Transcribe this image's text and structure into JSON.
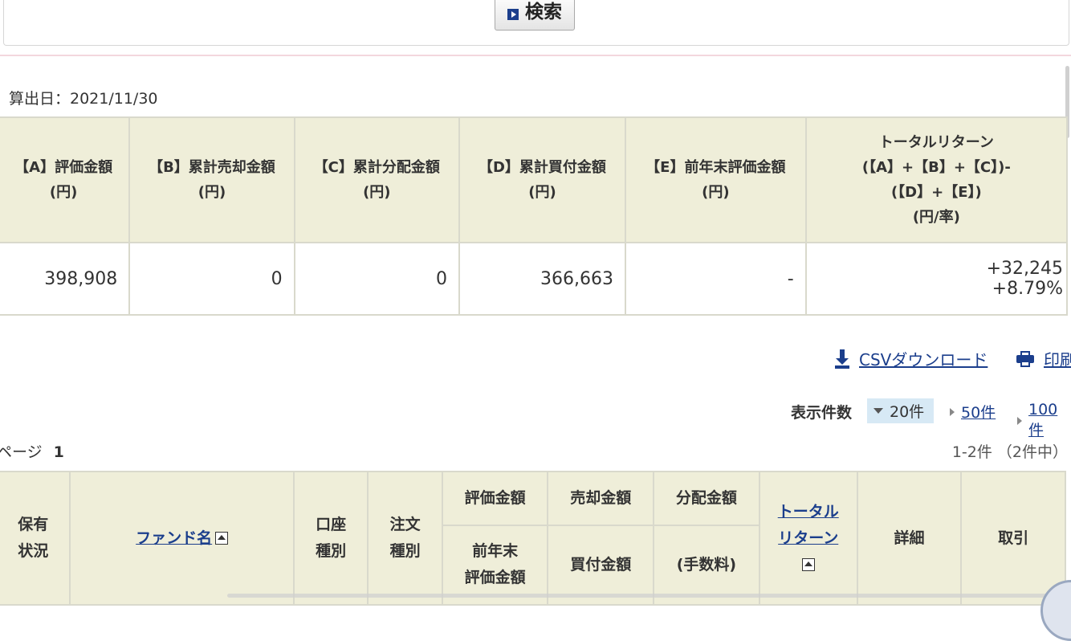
{
  "search": {
    "button_label": "検索"
  },
  "calc_date": "算出日：2021/11/30",
  "summary": {
    "headers": [
      [
        "【A】評価金額",
        "(円)"
      ],
      [
        "【B】累計売却金額",
        "(円)"
      ],
      [
        "【C】累計分配金額",
        "(円)"
      ],
      [
        "【D】累計買付金額",
        "(円)"
      ],
      [
        "【E】前年末評価金額",
        "(円)"
      ],
      [
        "トータルリターン",
        "(【A】+【B】+【C】)-",
        "(【D】+【E】)",
        "(円/率)"
      ]
    ],
    "values": [
      "398,908",
      "0",
      "0",
      "366,663",
      "-"
    ],
    "total_return_amount": "+32,245",
    "total_return_rate": "+8.79%"
  },
  "actions": {
    "csv_label": "CSVダウンロード",
    "print_label": "印刷"
  },
  "per_page": {
    "label": "表示件数",
    "selected": "20件",
    "options": [
      "50件",
      "100件"
    ]
  },
  "pagination": {
    "page_label": "ページ",
    "current_page": "1",
    "count_text": "1-2件 （2件中）"
  },
  "columns": {
    "holding_status": [
      "保有",
      "状況"
    ],
    "fund_name": "ファンド名",
    "account_type": [
      "口座",
      "種別"
    ],
    "order_type": [
      "注文",
      "種別"
    ],
    "valuation": "評価金額",
    "sale": "売却金額",
    "distribution": "分配金額",
    "prev_year_valuation": [
      "前年末",
      "評価金額"
    ],
    "purchase": "買付金額",
    "fee": "(手数料)",
    "total_return": [
      "トータル",
      "リターン"
    ],
    "detail": "詳細",
    "trade": "取引"
  },
  "colors": {
    "header_bg": "#efeed9",
    "link": "#1b3e8c",
    "positive": "#e8322f",
    "selected_bg": "#d7e9f5"
  }
}
